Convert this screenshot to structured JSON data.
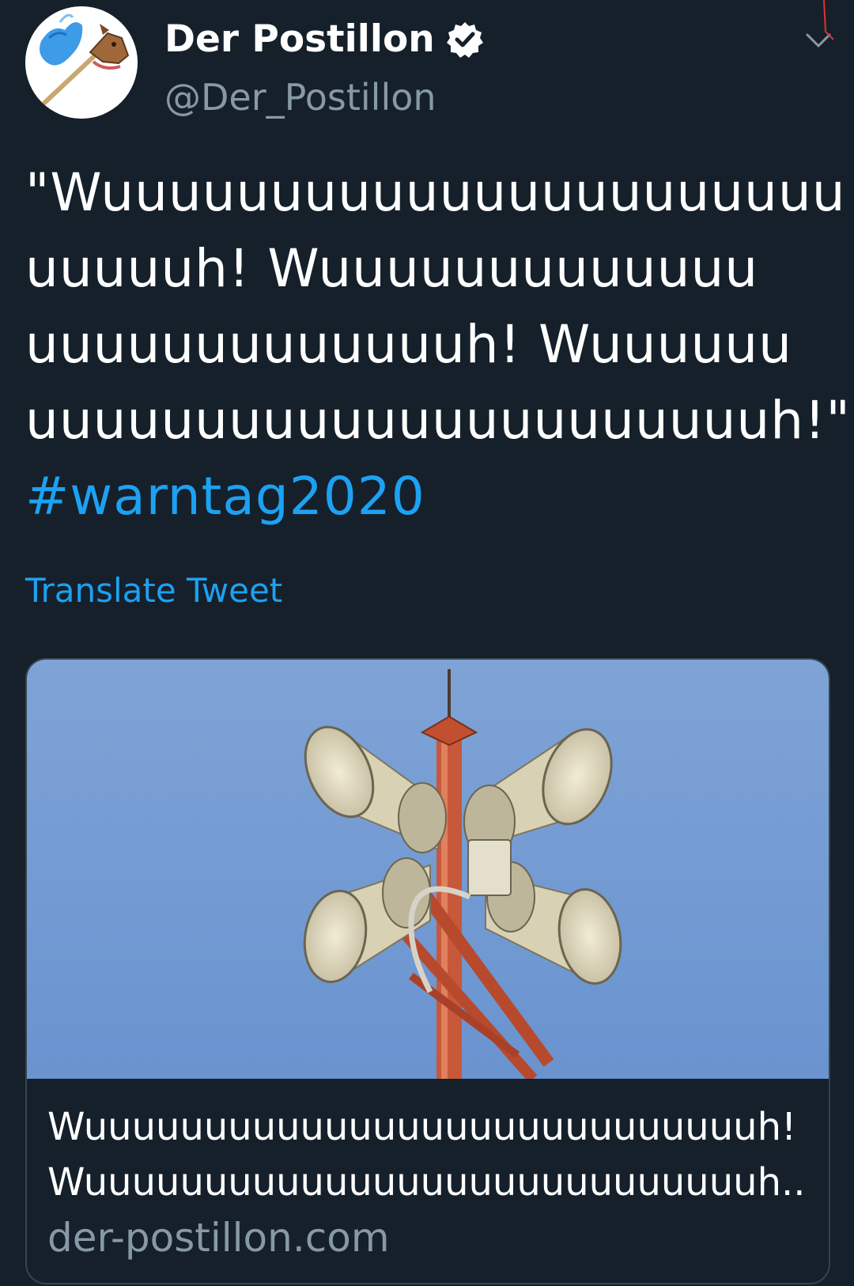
{
  "header": {
    "display_name": "Der Postillon",
    "handle": "@Der_Postillon",
    "avatar_icon": "horse-bird-logo"
  },
  "tweet": {
    "lines": [
      "\"Wuuuuuuuuuuuuuuuuuuuuuu",
      "uuuuuh! Wuuuuuuuuuuuuu",
      "uuuuuuuuuuuuuh! Wuuuuuu",
      "uuuuuuuuuuuuuuuuuuuuuuh!\""
    ],
    "hashtag": "#warntag2020",
    "translate_label": "Translate Tweet"
  },
  "card": {
    "title_lines": [
      "Wuuuuuuuuuuuuuuuuuuuuuuuuuuuuh!",
      "Wuuuuuuuuuuuuuuuuuuuuuuuuuuuuh..."
    ],
    "domain": "der-postillon.com",
    "image_subject": "siren-tower-photo"
  },
  "colors": {
    "background": "#15202b",
    "accent": "#1da1f2",
    "secondary_text": "#8899a6",
    "border": "#38444d"
  }
}
